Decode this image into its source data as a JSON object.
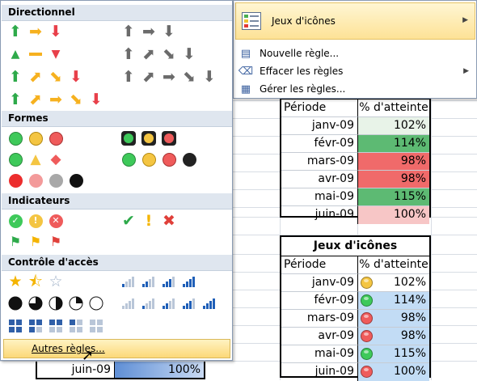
{
  "panel": {
    "sections": [
      {
        "label": "Directionnel"
      },
      {
        "label": "Formes"
      },
      {
        "label": "Indicateurs"
      },
      {
        "label": "Contrôle d'accès"
      }
    ],
    "more_rules": "Autres règles..."
  },
  "menu": {
    "top": "Jeux d'icônes",
    "items": [
      {
        "label": "Nouvelle règle..."
      },
      {
        "label": "Effacer les règles"
      },
      {
        "label": "Gérer les règles..."
      }
    ]
  },
  "table1": {
    "col1": "Période",
    "col2": "% d'atteinte",
    "rows": [
      {
        "period": "janv-09",
        "value": "102%",
        "color": "#e8f3e8"
      },
      {
        "period": "févr-09",
        "value": "114%",
        "color": "#5dba73"
      },
      {
        "period": "mars-09",
        "value": "98%",
        "color": "#f06a6a"
      },
      {
        "period": "avr-09",
        "value": "98%",
        "color": "#f06a6a"
      },
      {
        "period": "mai-09",
        "value": "115%",
        "color": "#5dba73"
      },
      {
        "period": "juin-09",
        "value": "100%",
        "color": "#f7c6c6"
      }
    ]
  },
  "table2": {
    "title": "Jeux d'icônes",
    "col1": "Période",
    "col2": "% d'atteinte",
    "rows": [
      {
        "period": "janv-09",
        "value": "102%",
        "icon": "#f4c542",
        "fill": "#ffffff"
      },
      {
        "period": "févr-09",
        "value": "114%",
        "icon": "#3ec95a",
        "fill": "#c2dcf5"
      },
      {
        "period": "mars-09",
        "value": "98%",
        "icon": "#ef5b5b",
        "fill": "#c2dcf5"
      },
      {
        "period": "avr-09",
        "value": "98%",
        "icon": "#ef5b5b",
        "fill": "#c2dcf5"
      },
      {
        "period": "mai-09",
        "value": "115%",
        "icon": "#3ec95a",
        "fill": "#c2dcf5"
      },
      {
        "period": "juin-09",
        "value": "100%",
        "icon": "#ef5b5b",
        "fill": "#c2dcf5"
      }
    ]
  },
  "bottom_row": {
    "period": "juin-09",
    "value": "100%"
  }
}
